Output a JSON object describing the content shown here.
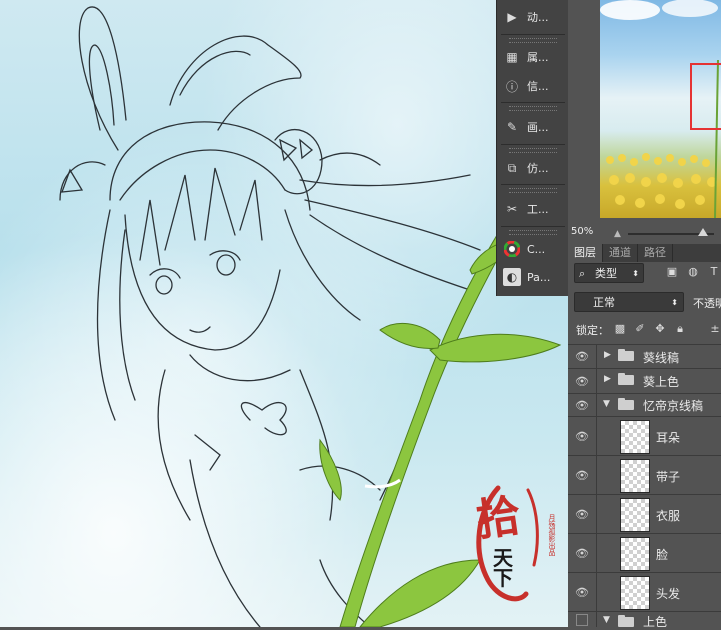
{
  "dock": {
    "items": [
      {
        "label": "动...",
        "icon": "play-actions-icon"
      },
      {
        "label": "属...",
        "icon": "properties-icon"
      },
      {
        "label": "信...",
        "icon": "info-icon"
      },
      {
        "label": "画...",
        "icon": "brush-presets-icon"
      },
      {
        "label": "仿...",
        "icon": "clone-source-icon"
      },
      {
        "label": "工...",
        "icon": "tool-presets-icon"
      },
      {
        "label": "C...",
        "icon": "color-wheel-icon"
      },
      {
        "label": "Pa...",
        "icon": "paths-app-icon"
      }
    ]
  },
  "navigator": {
    "zoom": "50%"
  },
  "panel_tabs": {
    "layers": "图层",
    "channels": "通道",
    "paths": "路径"
  },
  "filter": {
    "label": "类型"
  },
  "blend": {
    "mode": "正常",
    "opacity_label": "不透明"
  },
  "lock": {
    "label": "锁定："
  },
  "layers": [
    {
      "name": "葵线稿",
      "type": "group",
      "expanded": false
    },
    {
      "name": "葵上色",
      "type": "group",
      "expanded": false
    },
    {
      "name": "忆帝京线稿",
      "type": "group",
      "expanded": true
    },
    {
      "name": "耳朵",
      "type": "layer"
    },
    {
      "name": "带子",
      "type": "layer"
    },
    {
      "name": "衣服",
      "type": "layer"
    },
    {
      "name": "脸",
      "type": "layer"
    },
    {
      "name": "头发",
      "type": "layer"
    },
    {
      "name": "上色",
      "type": "group",
      "expanded": true
    }
  ],
  "seal": {
    "main": "拾",
    "sub": "天下",
    "side": "月殇孤影出品"
  },
  "colors": {
    "panel_bg": "#535353",
    "dock_bg": "#434343",
    "seal_red": "#c7302b",
    "nav_highlight": "#e53333"
  }
}
